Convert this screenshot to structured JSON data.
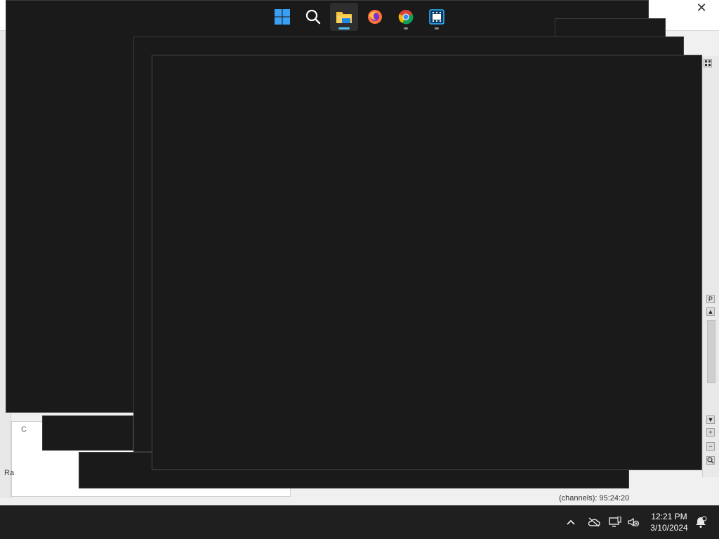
{
  "background_window": {
    "close_glyph": "✕",
    "panel_letter": "C",
    "side_label": "Ra",
    "status_text": "(channels): 95:24:20",
    "tools": {
      "grid_icon": "grid-icon",
      "p_tool_label": "P",
      "scroll_up": "▲",
      "scroll_down": "▼",
      "zoom_in": "+",
      "zoom_out": "−",
      "zoom_icon": "magnifier-icon"
    }
  },
  "taskbar": {
    "items": [
      {
        "name": "start",
        "icon": "windows-logo-icon"
      },
      {
        "name": "search",
        "icon": "search-icon"
      },
      {
        "name": "file-explorer",
        "icon": "folder-icon",
        "active": true
      },
      {
        "name": "firefox",
        "icon": "firefox-icon"
      },
      {
        "name": "chrome",
        "icon": "chrome-icon"
      },
      {
        "name": "video-editor",
        "icon": "film-icon"
      }
    ],
    "tray": {
      "overflow_icon": "chevron-up-icon",
      "onedrive_icon": "cloud-offline-icon",
      "network_icon": "network-icon",
      "volume_icon": "volume-muted-icon",
      "time": "12:21 PM",
      "date": "3/10/2024",
      "notification_icon": "bell-icon"
    }
  },
  "colors": {
    "dark_window": "#1a1a1a",
    "taskbar": "#1f1f1f",
    "accent": "#4fc3f7"
  }
}
